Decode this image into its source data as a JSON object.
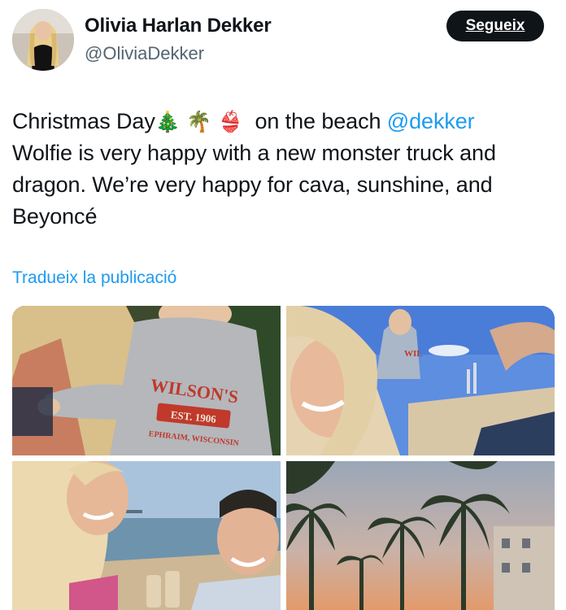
{
  "author": {
    "name": "Olivia Harlan Dekker",
    "handle": "@OliviaDekker",
    "avatar_icon": "profile-photo"
  },
  "follow_button": {
    "label": "Segueix"
  },
  "tweet": {
    "text_start": "Christmas Day",
    "emojis": [
      "🎄",
      "🌴",
      "👙"
    ],
    "text_after_emoji": "on the beach",
    "mention": "@dekker",
    "text_rest": "Wolfie is very happy with a new monster truck and dragon. We’re very happy for cava, sunshine, and Beyoncé"
  },
  "translate_link": "Tradueix la publicació",
  "media": {
    "photo1": {
      "shirt_brand": "WILSON'S",
      "shirt_est": "EST. 1906",
      "shirt_place": "EPHRAIM, WISCONSIN"
    },
    "photo2": {
      "shirt_text": "WIL"
    }
  },
  "colors": {
    "accent": "#1d9bf0",
    "text": "#0f1419",
    "secondary": "#536471",
    "button_bg": "#0f1419"
  }
}
